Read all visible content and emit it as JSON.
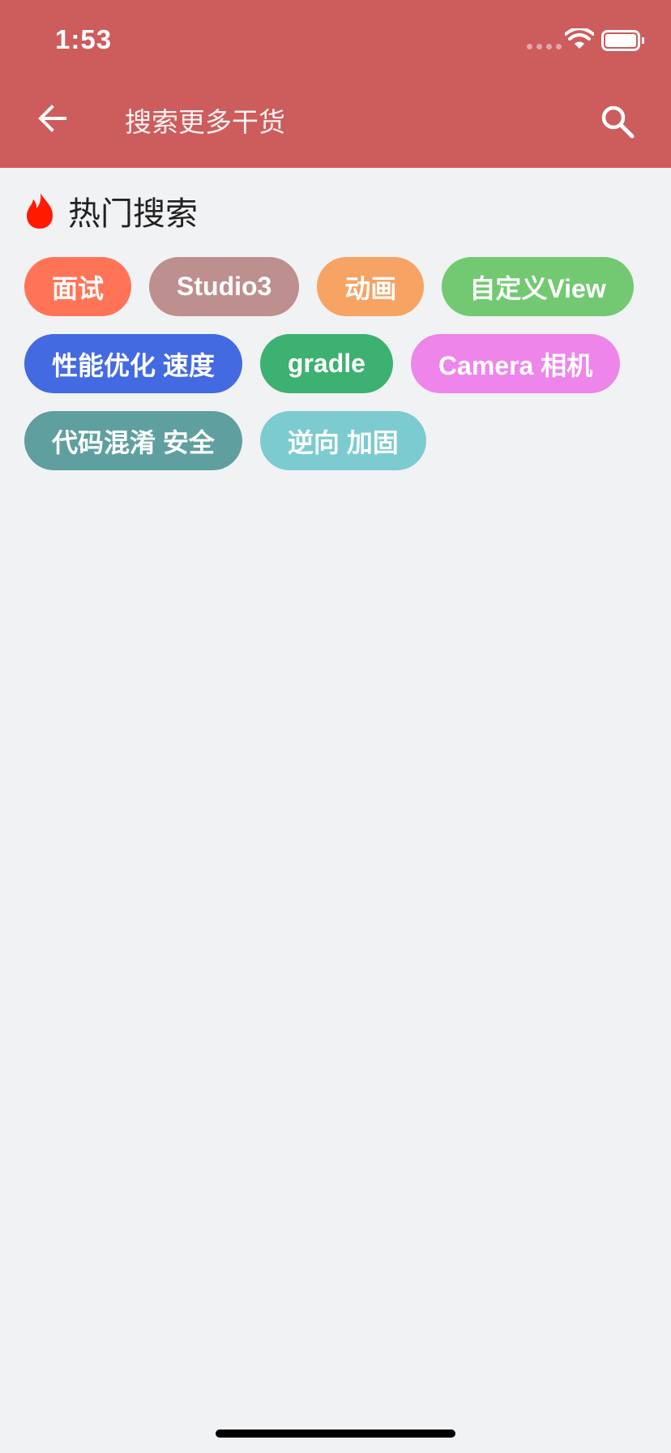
{
  "status_bar": {
    "time": "1:53"
  },
  "header": {
    "back_icon": "arrow-left-icon",
    "search_placeholder": "搜索更多干货",
    "search_icon": "search-icon",
    "background_color": "#cd5c5c"
  },
  "hot_search": {
    "icon": "fire-icon",
    "title": "热门搜索",
    "tags": [
      {
        "label": "面试",
        "color": "#ff7457"
      },
      {
        "label": "Studio3",
        "color": "#bd8f8f"
      },
      {
        "label": "动画",
        "color": "#f6a364"
      },
      {
        "label": "自定义View",
        "color": "#72c971"
      },
      {
        "label": "性能优化 速度",
        "color": "#436ae0"
      },
      {
        "label": "gradle",
        "color": "#3cb171"
      },
      {
        "label": "Camera 相机",
        "color": "#ee85ea"
      },
      {
        "label": "代码混淆 安全",
        "color": "#5f9f9f"
      },
      {
        "label": "逆向 加固",
        "color": "#7ccbd1"
      }
    ]
  }
}
